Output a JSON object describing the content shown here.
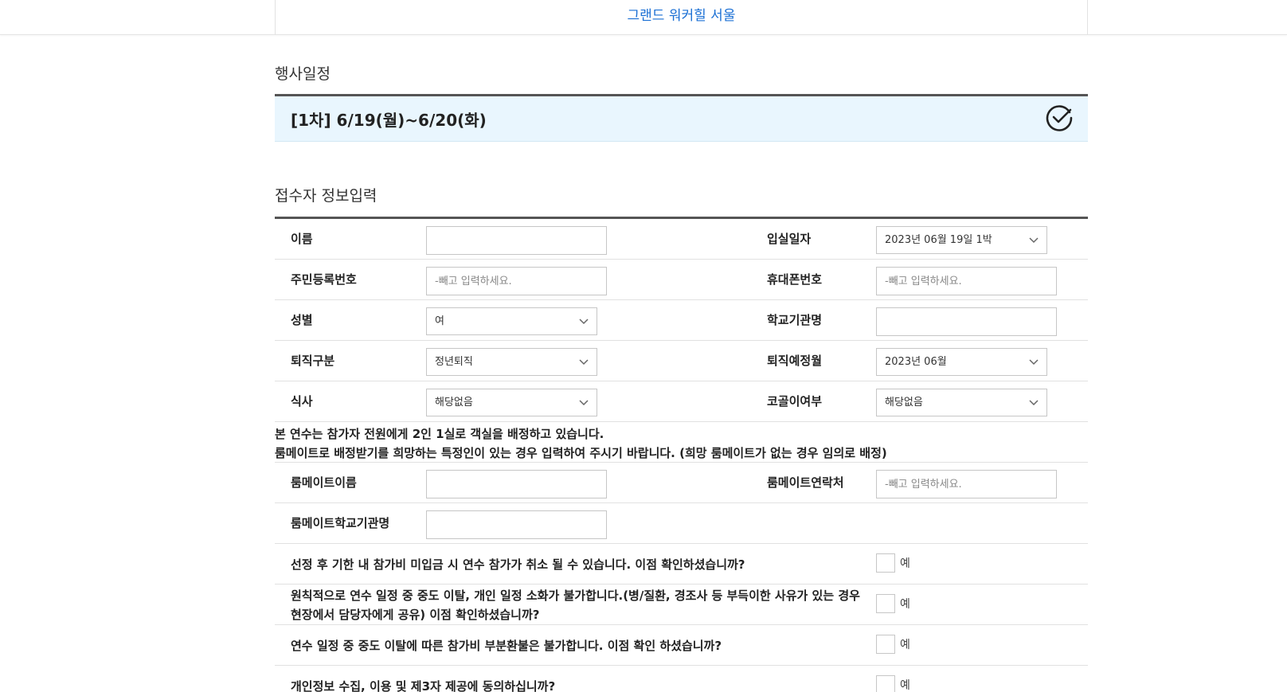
{
  "header": {
    "venue": "그랜드 워커힐 서울"
  },
  "schedule": {
    "title": "행사일정",
    "selected": "[1차] 6/19(월)~6/20(화)"
  },
  "form": {
    "title": "접수자 정보입력",
    "name_label": "이름",
    "checkin_label": "입실일자",
    "checkin_value": "2023년 06월 19일 1박",
    "rrn_label": "주민등록번호",
    "rrn_placeholder": "-빼고 입력하세요.",
    "phone_label": "휴대폰번호",
    "phone_placeholder": "-빼고 입력하세요.",
    "gender_label": "성별",
    "gender_value": "여",
    "school_label": "학교기관명",
    "retire_type_label": "퇴직구분",
    "retire_type_value": "정년퇴직",
    "retire_month_label": "퇴직예정월",
    "retire_month_value": "2023년 06월",
    "meal_label": "식사",
    "meal_value": "해당없음",
    "snore_label": "코골이여부",
    "snore_value": "해당없음",
    "notice_line1": "본 연수는 참가자 전원에게 2인 1실로 객실을 배정하고 있습니다.",
    "notice_line2": "룸메이트로 배정받기를 희망하는 특정인이 있는 경우 입력하여 주시기 바랍니다. (희망 룸메이트가 없는 경우 임의로 배정)",
    "roommate_name_label": "룸메이트이름",
    "roommate_contact_label": "룸메이트연락처",
    "roommate_contact_placeholder": "-빼고 입력하세요.",
    "roommate_school_label": "룸메이트학교기관명"
  },
  "confirmations": [
    {
      "text": "선정 후 기한 내 참가비 미입금 시 연수 참가가 취소 될 수 있습니다. 이점 확인하셨습니까?",
      "option": "예"
    },
    {
      "text": "원칙적으로 연수 일정 중 중도 이탈, 개인 일정 소화가 불가합니다.(병/질환, 경조사 등 부득이한 사유가 있는 경우 현장에서 담당자에게 공유) 이점 확인하셨습니까?",
      "option": "예"
    },
    {
      "text": "연수 일정 중 중도 이탈에 따른 참가비 부분환불은 불가합니다. 이점 확인 하셨습니까?",
      "option": "예"
    },
    {
      "text": "개인정보 수집, 이용 및 제3자 제공에 동의하십니까?",
      "option": "예"
    }
  ],
  "colors": {
    "accent": "#1a6fd4",
    "schedule_bg": "#e9f6fe",
    "border_dark": "#555555"
  }
}
